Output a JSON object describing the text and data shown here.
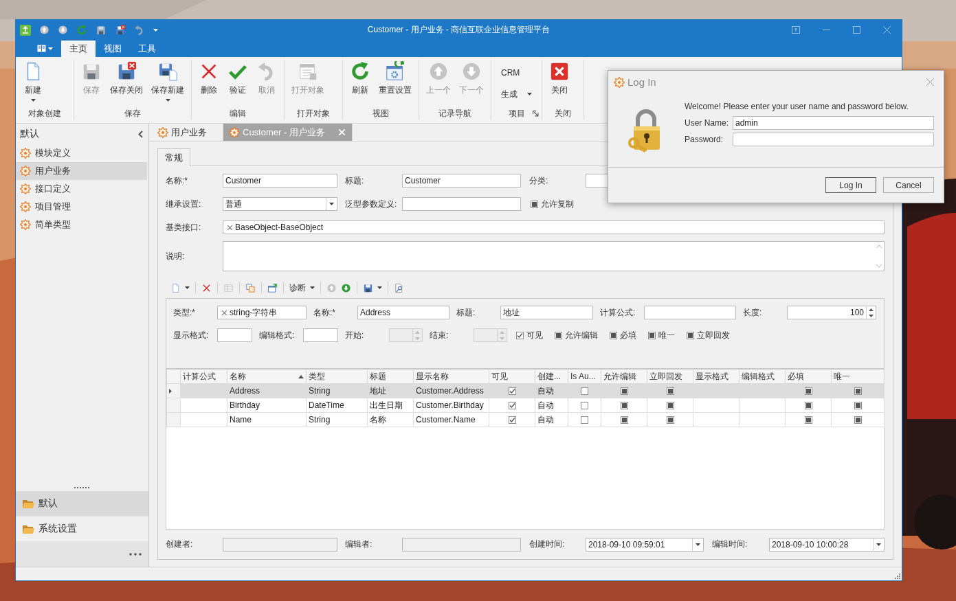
{
  "window": {
    "title": "Customer - 用户业务 - 商信互联企业信息管理平台"
  },
  "ribbon": {
    "tabs": [
      {
        "label": "主页",
        "selected": true
      },
      {
        "label": "视图",
        "selected": false
      },
      {
        "label": "工具",
        "selected": false
      }
    ],
    "groups": [
      {
        "label": "对象创建",
        "buttons": [
          {
            "kind": "new",
            "label": "新建",
            "disabled": false,
            "dropdown": true
          }
        ]
      },
      {
        "label": "保存",
        "buttons": [
          {
            "kind": "save",
            "label": "保存",
            "disabled": true,
            "dropdown": false
          },
          {
            "kind": "save-close",
            "label": "保存关闭",
            "disabled": false,
            "dropdown": false
          },
          {
            "kind": "save-new",
            "label": "保存新建",
            "disabled": false,
            "dropdown": true
          }
        ]
      },
      {
        "label": "编辑",
        "buttons": [
          {
            "kind": "delete",
            "label": "删除",
            "disabled": false,
            "dropdown": false
          },
          {
            "kind": "validate",
            "label": "验证",
            "disabled": false,
            "dropdown": false
          },
          {
            "kind": "undo",
            "label": "取消",
            "disabled": true,
            "dropdown": false
          }
        ]
      },
      {
        "label": "打开对象",
        "buttons": [
          {
            "kind": "open",
            "label": "打开对象",
            "disabled": true,
            "dropdown": false
          }
        ]
      },
      {
        "label": "视图",
        "buttons": [
          {
            "kind": "refresh",
            "label": "刷新",
            "disabled": false,
            "dropdown": false
          },
          {
            "kind": "reset",
            "label": "重置设置",
            "disabled": false,
            "dropdown": false
          }
        ]
      },
      {
        "label": "记录导航",
        "buttons": [
          {
            "kind": "up",
            "label": "上一个",
            "disabled": true,
            "dropdown": false
          },
          {
            "kind": "down",
            "label": "下一个",
            "disabled": true,
            "dropdown": false
          }
        ]
      },
      {
        "label": "项目",
        "launcher": true,
        "buttons": [
          {
            "kind": "text",
            "label": "CRM",
            "dropdown": false
          },
          {
            "kind": "text",
            "label": "生成",
            "dropdown": true
          }
        ]
      },
      {
        "label": "关闭",
        "buttons": [
          {
            "kind": "close",
            "label": "关闭",
            "disabled": false,
            "dropdown": false
          }
        ]
      }
    ]
  },
  "sidebar": {
    "title": "默认",
    "items": [
      {
        "label": "模块定义",
        "selected": false
      },
      {
        "label": "用户业务",
        "selected": true
      },
      {
        "label": "接口定义",
        "selected": false
      },
      {
        "label": "项目管理",
        "selected": false
      },
      {
        "label": "简单类型",
        "selected": false
      }
    ],
    "groups": [
      {
        "label": "默认",
        "selected": true
      },
      {
        "label": "系统设置",
        "selected": false
      }
    ]
  },
  "document_tabs": [
    {
      "label": "用户业务",
      "selected": false,
      "closable": false
    },
    {
      "label": "Customer - 用户业务",
      "selected": true,
      "closable": true
    }
  ],
  "form": {
    "page_tabs": [
      {
        "label": "常规",
        "selected": true
      }
    ],
    "row_1": [
      {
        "label": "名称:*",
        "value": "Customer"
      },
      {
        "label": "标题:",
        "value": "Customer"
      },
      {
        "label": "分类:"
      }
    ],
    "inheritance": {
      "label": "继承设置:",
      "value": "普通"
    },
    "generic_params": {
      "label": "泛型参数定义:"
    },
    "checks": [
      {
        "label": "允许复制",
        "checked": false,
        "indeterminate": true
      }
    ],
    "base_interface": {
      "label": "基类接口:",
      "token": "BaseObject-BaseObject"
    },
    "description": {
      "label": "说明:"
    }
  },
  "field_toolbar": [
    [
      {
        "kind": "new",
        "dropdown": true,
        "disabled": false
      }
    ],
    [
      {
        "kind": "delete",
        "dropdown": false,
        "disabled": false
      }
    ],
    [
      {
        "kind": "grid",
        "dropdown": false,
        "disabled": true
      }
    ],
    [
      {
        "kind": "copy",
        "dropdown": false,
        "disabled": false
      }
    ],
    [
      {
        "kind": "window-arrow",
        "dropdown": false,
        "disabled": false
      }
    ],
    [
      {
        "kind": "text",
        "label": "诊断",
        "dropdown": true
      }
    ],
    [
      {
        "kind": "up",
        "dropdown": false,
        "disabled": true
      },
      {
        "kind": "down",
        "dropdown": false,
        "disabled": false
      }
    ],
    [
      {
        "kind": "save",
        "dropdown": true,
        "disabled": false
      }
    ],
    [
      {
        "kind": "find",
        "dropdown": false,
        "disabled": false
      }
    ]
  ],
  "field_detail": {
    "row_1": [
      {
        "kind": "token",
        "label": "类型:*",
        "value": "string-字符串"
      },
      {
        "kind": "text",
        "label": "名称:*",
        "value": "Address"
      },
      {
        "kind": "text",
        "label": "标题:",
        "value": "地址"
      },
      {
        "kind": "text",
        "label": "计算公式:"
      },
      {
        "kind": "spin",
        "label": "长度:",
        "value": "100",
        "disabled": false
      }
    ],
    "row_2": [
      {
        "kind": "text",
        "label": "显示格式:"
      },
      {
        "kind": "text",
        "label": "编辑格式:"
      },
      {
        "kind": "spin",
        "label": "开始:",
        "disabled": true
      },
      {
        "kind": "spin",
        "label": "结束:",
        "disabled": true
      }
    ],
    "checks": [
      {
        "label": "可见",
        "checked": true
      },
      {
        "label": "允许编辑",
        "checked": false,
        "indeterminate": true
      },
      {
        "label": "必填",
        "checked": false,
        "indeterminate": true
      },
      {
        "label": "唯一",
        "checked": false,
        "indeterminate": true
      },
      {
        "label": "立即回发",
        "checked": false,
        "indeterminate": true
      }
    ]
  },
  "grid": {
    "columns": [
      {
        "label": "计算公式",
        "sorted": false
      },
      {
        "label": "名称",
        "sorted": true
      },
      {
        "label": "类型",
        "sorted": false
      },
      {
        "label": "标题",
        "sorted": false
      },
      {
        "label": "显示名称",
        "sorted": false
      },
      {
        "label": "可见",
        "sorted": false
      },
      {
        "label": "创建...",
        "sorted": false
      },
      {
        "label": "Is Au...",
        "sorted": false
      },
      {
        "label": "允许编辑",
        "sorted": false
      },
      {
        "label": "立即回发",
        "sorted": false
      },
      {
        "label": "显示格式",
        "sorted": false
      },
      {
        "label": "编辑格式",
        "sorted": false
      },
      {
        "label": "必填",
        "sorted": false
      },
      {
        "label": "唯一",
        "sorted": false
      }
    ],
    "rows": [
      {
        "selected": true,
        "cells": [
          null,
          "Address",
          "String",
          "地址",
          "Customer.Address",
          {
            "checked": true
          },
          "自动",
          {
            "checked": false
          },
          {
            "checked": false,
            "indeterminate": true
          },
          {
            "checked": false,
            "indeterminate": true
          },
          null,
          null,
          {
            "checked": false,
            "indeterminate": true
          },
          {
            "checked": false,
            "indeterminate": true
          }
        ]
      },
      {
        "selected": false,
        "cells": [
          null,
          "Birthday",
          "DateTime",
          "出生日期",
          "Customer.Birthday",
          {
            "checked": true
          },
          "自动",
          {
            "checked": false
          },
          {
            "checked": false,
            "indeterminate": true
          },
          {
            "checked": false,
            "indeterminate": true
          },
          null,
          null,
          {
            "checked": false,
            "indeterminate": true
          },
          {
            "checked": false,
            "indeterminate": true
          }
        ]
      },
      {
        "selected": false,
        "cells": [
          null,
          "Name",
          "String",
          "名称",
          "Customer.Name",
          {
            "checked": true
          },
          "自动",
          {
            "checked": false
          },
          {
            "checked": false,
            "indeterminate": true
          },
          {
            "checked": false,
            "indeterminate": true
          },
          null,
          null,
          {
            "checked": false,
            "indeterminate": true
          },
          {
            "checked": false,
            "indeterminate": true
          }
        ]
      }
    ]
  },
  "footer": [
    {
      "kind": "text",
      "label": "创建者:",
      "disabled": true
    },
    {
      "kind": "text",
      "label": "编辑者:",
      "disabled": true
    },
    {
      "kind": "combo",
      "label": "创建时间:",
      "value": "2018-09-10 09:59:01",
      "disabled": false
    },
    {
      "kind": "combo",
      "label": "编辑时间:",
      "value": "2018-09-10 10:00:28",
      "disabled": false
    }
  ],
  "login_dialog": {
    "title": "Log In",
    "message": "Welcome! Please enter your user name and password below.",
    "fields": [
      {
        "label": "User Name:",
        "value": "admin"
      },
      {
        "label": "Password:"
      }
    ],
    "buttons": [
      {
        "label": "Log In",
        "default": true
      },
      {
        "label": "Cancel",
        "default": false
      }
    ]
  }
}
